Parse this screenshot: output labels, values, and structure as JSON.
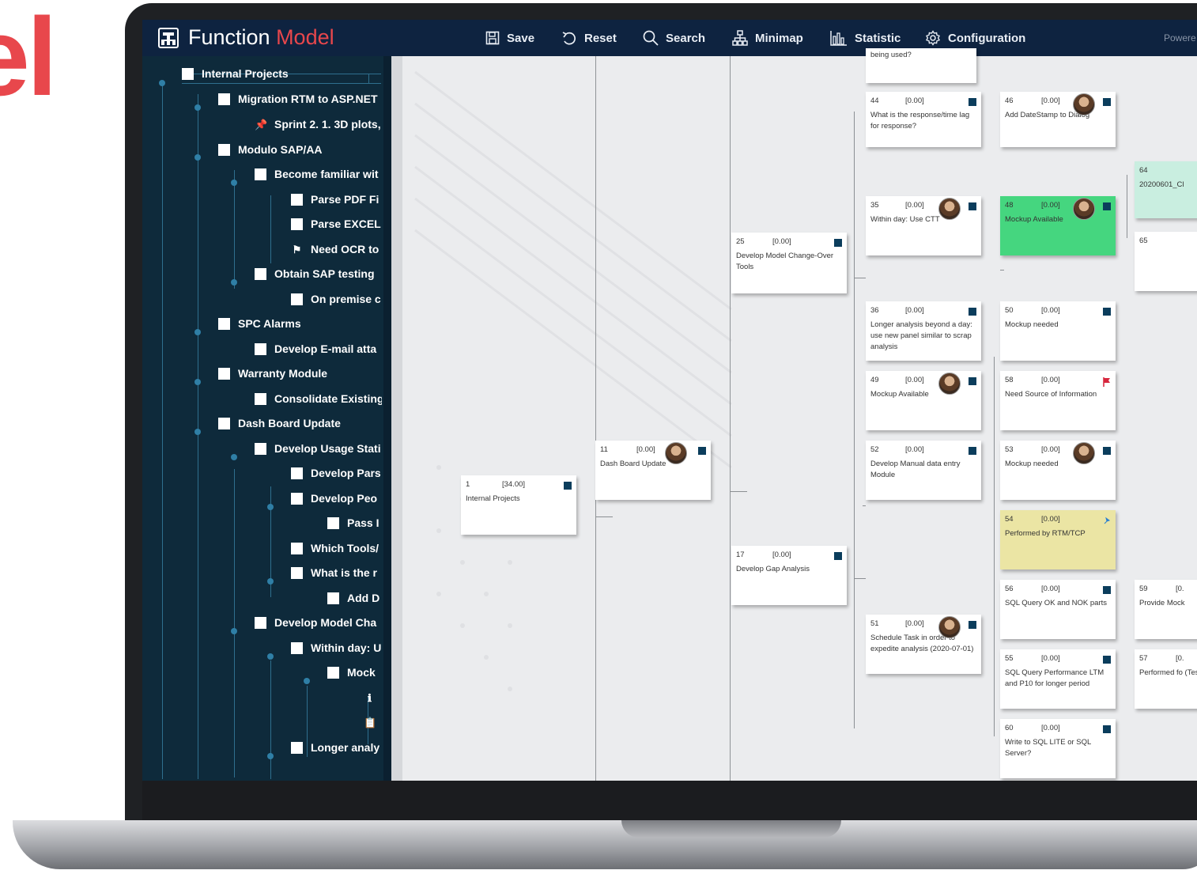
{
  "branding": {
    "background_word": "el",
    "title_main": "Function ",
    "title_accent": "Model",
    "accent_color": "#e8474c"
  },
  "toolbar": {
    "save": "Save",
    "reset": "Reset",
    "search": "Search",
    "minimap": "Minimap",
    "statistic": "Statistic",
    "configuration": "Configuration",
    "powered": "Powere"
  },
  "tree": [
    {
      "label": "Internal Projects",
      "icon": "checkbox"
    },
    {
      "label": "Migration RTM to ASP.NET",
      "icon": "checkbox"
    },
    {
      "label": "Sprint 2. 1. 3D plots,",
      "icon": "pin-icon"
    },
    {
      "label": "Modulo SAP/AA",
      "icon": "checkbox"
    },
    {
      "label": "Become familiar wit",
      "icon": "checkbox"
    },
    {
      "label": "Parse PDF Fi",
      "icon": "checkbox"
    },
    {
      "label": "Parse EXCEL",
      "icon": "checkbox"
    },
    {
      "label": "Need OCR to",
      "icon": "flag-icon"
    },
    {
      "label": "Obtain SAP testing ",
      "icon": "checkbox"
    },
    {
      "label": "On premise c",
      "icon": "checkbox"
    },
    {
      "label": "SPC Alarms",
      "icon": "checkbox"
    },
    {
      "label": "Develop E-mail atta",
      "icon": "checkbox"
    },
    {
      "label": "Warranty Module",
      "icon": "checkbox"
    },
    {
      "label": "Consolidate Existing",
      "icon": "checkbox"
    },
    {
      "label": "Dash Board Update",
      "icon": "checkbox"
    },
    {
      "label": "Develop Usage Stati",
      "icon": "checkbox"
    },
    {
      "label": "Develop Pars",
      "icon": "checkbox"
    },
    {
      "label": "Develop Peo",
      "icon": "checkbox"
    },
    {
      "label": "Pass I",
      "icon": "checkbox"
    },
    {
      "label": "Which Tools/",
      "icon": "checkbox"
    },
    {
      "label": "What is the r",
      "icon": "checkbox"
    },
    {
      "label": "Add D",
      "icon": "checkbox"
    },
    {
      "label": "Develop Model Cha",
      "icon": "checkbox"
    },
    {
      "label": "Within day: U",
      "icon": "checkbox"
    },
    {
      "label": "Mock",
      "icon": "checkbox"
    },
    {
      "label": "",
      "icon": "info-icon"
    },
    {
      "label": "",
      "icon": "clipboard-icon"
    },
    {
      "label": "Longer analy",
      "icon": "checkbox"
    }
  ],
  "cards": [
    {
      "id": "",
      "value": "",
      "text": "being used?"
    },
    {
      "id": "44",
      "value": "[0.00]",
      "text": "What is the response/time lag for response?"
    },
    {
      "id": "46",
      "value": "[0.00]",
      "text": "Add DateStamp to Dialog"
    },
    {
      "id": "64",
      "value": "",
      "text": "20200601_Cl"
    },
    {
      "id": "35",
      "value": "[0.00]",
      "text": "Within day: Use CTT"
    },
    {
      "id": "48",
      "value": "[0.00]",
      "text": "Mockup Available"
    },
    {
      "id": "65",
      "value": "",
      "text": ""
    },
    {
      "id": "25",
      "value": "[0.00]",
      "text": "Develop Model Change-Over Tools"
    },
    {
      "id": "36",
      "value": "[0.00]",
      "text": "Longer analysis beyond a day: use new panel similar to scrap analysis"
    },
    {
      "id": "50",
      "value": "[0.00]",
      "text": "Mockup needed"
    },
    {
      "id": "49",
      "value": "[0.00]",
      "text": "Mockup Available"
    },
    {
      "id": "58",
      "value": "[0.00]",
      "text": "Need Source of Information"
    },
    {
      "id": "11",
      "value": "[0.00]",
      "text": "Dash Board Update"
    },
    {
      "id": "52",
      "value": "[0.00]",
      "text": "Develop Manual data entry Module"
    },
    {
      "id": "53",
      "value": "[0.00]",
      "text": "Mockup needed"
    },
    {
      "id": "1",
      "value": "[34.00]",
      "text": "Internal Projects"
    },
    {
      "id": "54",
      "value": "[0.00]",
      "text": "Performed by RTM/TCP"
    },
    {
      "id": "17",
      "value": "[0.00]",
      "text": "Develop Gap Analysis"
    },
    {
      "id": "56",
      "value": "[0.00]",
      "text": "SQL Query OK and NOK parts"
    },
    {
      "id": "59",
      "value": "[0.",
      "text": "Provide Mock"
    },
    {
      "id": "51",
      "value": "[0.00]",
      "text": "Schedule Task in order to expedite analysis (2020-07-01)"
    },
    {
      "id": "55",
      "value": "[0.00]",
      "text": "SQL Query Performance LTM and P10 for longer period"
    },
    {
      "id": "57",
      "value": "[0.",
      "text": "Performed fo (Test Plan)"
    },
    {
      "id": "60",
      "value": "[0.00]",
      "text": "Write to SQL LITE or SQL Server?"
    }
  ],
  "colors": {
    "topbar": "#0e2340",
    "sidebar": "#0e2a3b",
    "card_green": "#45d67f",
    "card_yellow": "#ebe5a4",
    "flag_blue": "#0b3d5c",
    "flag_red": "#d7263d"
  }
}
